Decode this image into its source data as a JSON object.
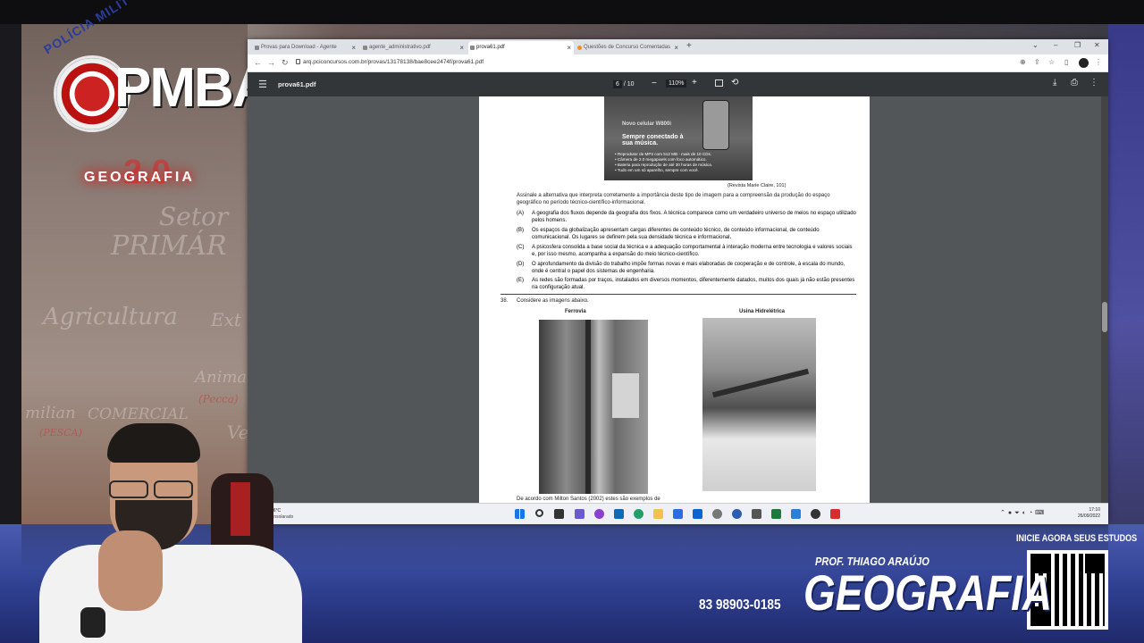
{
  "overlay": {
    "logo_arc_text": "POLÍCIA MILIT",
    "logo_text": "PMBA",
    "geo_logo_text": "GEOGRAFIA",
    "geo_logo_number": "2.0",
    "cta": "INICIE AGORA SEUS ESTUDOS",
    "prof": "PROF. THIAGO ARAÚJO",
    "subject": "GEOGRAFIA",
    "phone": "83 98903-0185",
    "chalk": [
      "Setor",
      "PRIMÁR",
      "Agricultura",
      "Animal",
      "(Pecca)",
      "milian",
      "COMERCIAL",
      "(PESCA)",
      "Ext",
      "Ve",
      "A"
    ]
  },
  "browser": {
    "tabs": [
      {
        "label": "Provas para Download - Agente",
        "active": false,
        "icon": "pdf-icon"
      },
      {
        "label": "agente_administrativo.pdf",
        "active": false,
        "icon": "pdf-icon"
      },
      {
        "label": "prova61.pdf",
        "active": true,
        "icon": "pdf-icon"
      },
      {
        "label": "Questões de Concurso Comentadas",
        "active": false,
        "icon": "site-icon"
      }
    ],
    "url": "arq.pciconcursos.com.br/provas/13178138/bae8cee2474f/prova61.pdf"
  },
  "pdf": {
    "title": "prova61.pdf",
    "page_current": "6",
    "page_total": "/ 10",
    "zoom": "110%",
    "ad": {
      "title": "Novo celular W800i",
      "slogan": "Sempre conectado à sua música.",
      "bullets": [
        "• Reprodutor de MP3 com 512 MB - mais de 10 CDs.",
        "• Câmera de 2.0 megapixels com foco automático.",
        "• Bateria para reprodução de até 30 horas de música.",
        "• Tudo em um só aparelho, sempre com você."
      ]
    },
    "source": "(Revista Marie Claire, 101)",
    "q37_stem": "Assinale a alternativa que interpreta corretamente a importância deste tipo de imagem para a compreensão da produção do espaço geográfico no período técnico-científico-informacional.",
    "q37_options": [
      {
        "letter": "(A)",
        "text": "A geografia dos fluxos depende da geografia dos fixos. A técnica comparece como um verdadeiro universo de meios no espaço utilizado pelos homens."
      },
      {
        "letter": "(B)",
        "text": "Os espaços da globalização apresentam cargas diferentes de conteúdo técnico, de conteúdo informacional, de conteúdo comunicacional. Os lugares se definem pela sua densidade técnica e informacional."
      },
      {
        "letter": "(C)",
        "text": "A psicosfera consolida a base social da técnica e a adequação comportamental à interação moderna entre tecnologia e valores sociais e, por isso mesmo, acompanha a expansão do meio técnico-científico."
      },
      {
        "letter": "(D)",
        "text": "O aprofundamento da divisão do trabalho impõe formas novas e mais elaboradas de cooperação e de controle, à escala do mundo, onde é central o papel dos sistemas de engenharia."
      },
      {
        "letter": "(E)",
        "text": "As redes são formadas por traços, instalados em diversos momentos, diferentemente datados, muitos dos quais já não estão presentes na configuração atual."
      }
    ],
    "q38_number": "38.",
    "q38_stem": "Considere as imagens abaixo.",
    "caption_left": "Ferrovia",
    "caption_right": "Usina Hidrelétrica",
    "q38_tail": "De acordo com Milton Santos (2002) estes são exemplos de"
  },
  "taskbar": {
    "weather_temp": "26°C",
    "weather_desc": "Ensolarado",
    "time": "17:10",
    "date": "26/09/2022"
  }
}
